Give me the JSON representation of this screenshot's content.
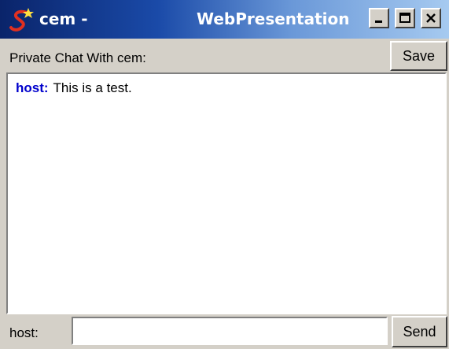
{
  "window": {
    "title_left": "cem -",
    "title_right": "WebPresentation",
    "controls": {
      "minimize_icon": "minimize-icon",
      "maximize_icon": "maximize-icon",
      "close_icon": "close-icon"
    }
  },
  "header": {
    "label": "Private Chat With cem:",
    "save_label": "Save"
  },
  "chat": {
    "messages": [
      {
        "sender": "host:",
        "text": "This is a test."
      }
    ]
  },
  "input_row": {
    "label": "host:",
    "value": "",
    "send_label": "Send"
  },
  "colors": {
    "title_gradient_start": "#0a246a",
    "title_gradient_end": "#a6caf0",
    "sender": "#0000cc",
    "face": "#d4d0c8"
  }
}
